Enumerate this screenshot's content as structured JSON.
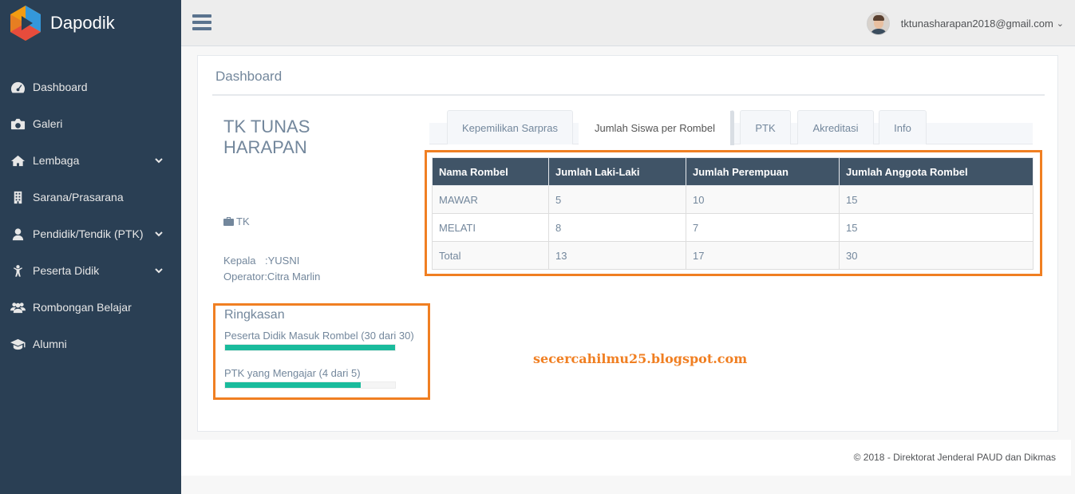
{
  "app": {
    "name": "Dapodik",
    "colors": {
      "sidebar": "#2a3f54",
      "accent": "#1abb9c",
      "highlight": "#f07f22",
      "table_header": "#405467"
    }
  },
  "sidebar": {
    "items": [
      {
        "label": "Dashboard",
        "icon": "dashboard-icon",
        "expandable": false
      },
      {
        "label": "Galeri",
        "icon": "camera-icon",
        "expandable": false
      },
      {
        "label": "Lembaga",
        "icon": "home-icon",
        "expandable": true
      },
      {
        "label": "Sarana/Prasarana",
        "icon": "building-icon",
        "expandable": false
      },
      {
        "label": "Pendidik/Tendik (PTK)",
        "icon": "user-icon",
        "expandable": true
      },
      {
        "label": "Peserta Didik",
        "icon": "child-icon",
        "expandable": true
      },
      {
        "label": "Rombongan Belajar",
        "icon": "users-icon",
        "expandable": false
      },
      {
        "label": "Alumni",
        "icon": "graduation-cap-icon",
        "expandable": false
      }
    ]
  },
  "topbar": {
    "user_email": "tktunasharapan2018@gmail.com",
    "caret": "⌄"
  },
  "panel": {
    "title": "Dashboard",
    "school": {
      "name": "TK TUNAS HARAPAN",
      "type": "TK",
      "kepala_label": "Kepala",
      "kepala_value": ":YUSNI",
      "operator_label": "Operator",
      "operator_value": ":Citra Marlin"
    },
    "ringkasan": {
      "title": "Ringkasan",
      "items": [
        {
          "label": "Peserta Didik Masuk Rombel (30 dari 30)",
          "fraction": 1.0
        },
        {
          "label": "PTK yang Mengajar (4 dari 5)",
          "fraction": 0.8
        }
      ]
    },
    "tabs": [
      {
        "label": "Kepemilikan Sarpras",
        "active": false
      },
      {
        "label": "Jumlah Siswa per Rombel",
        "active": true
      },
      {
        "label": "PTK",
        "active": false
      },
      {
        "label": "Akreditasi",
        "active": false
      },
      {
        "label": "Info",
        "active": false
      }
    ],
    "table": {
      "headers": [
        "Nama Rombel",
        "Jumlah Laki-Laki",
        "Jumlah Perempuan",
        "Jumlah Anggota Rombel"
      ],
      "rows": [
        [
          "MAWAR",
          "5",
          "10",
          "15"
        ],
        [
          "MELATI",
          "8",
          "7",
          "15"
        ],
        [
          "Total",
          "13",
          "17",
          "30"
        ]
      ]
    },
    "watermark": "secercahilmu25.blogspot.com"
  },
  "footer": {
    "text": "©   2018 - Direktorat Jenderal PAUD dan Dikmas"
  }
}
